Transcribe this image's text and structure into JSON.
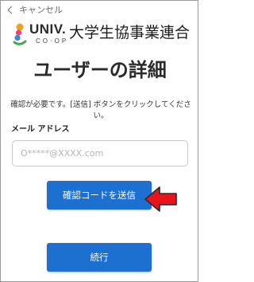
{
  "nav": {
    "cancel_label": "キャンセル"
  },
  "logo": {
    "brand": "UNIV.",
    "coop": "CO·OP",
    "organization": "大学生協事業連合"
  },
  "page": {
    "title": "ユーザーの詳細",
    "description": "確認が必要です。[送信] ボタンをクリックしてください。"
  },
  "email": {
    "label": "メール アドレス",
    "placeholder": "O*****@XXXX.com",
    "value": ""
  },
  "buttons": {
    "send_code": "確認コードを送信",
    "continue": "続行"
  },
  "colors": {
    "primary": "#1d6fd0",
    "annotation_arrow": "#e8141b"
  },
  "icons": {
    "back": "chevron-left-icon",
    "annotation": "red-arrow-icon"
  }
}
